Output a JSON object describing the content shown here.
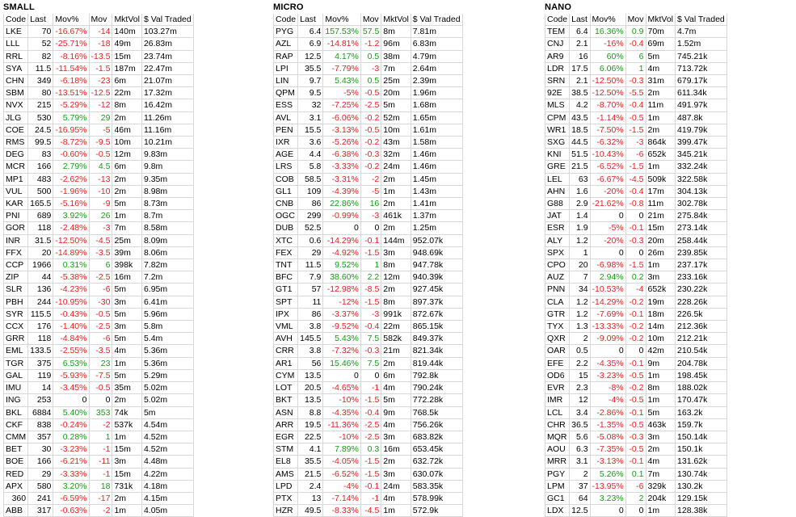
{
  "columns": [
    "Code",
    "Last",
    "Mov%",
    "Mov",
    "MktVol",
    "$ Val Traded"
  ],
  "colors": {
    "negative": "#ee1c1c",
    "positive": "#10a010",
    "grid": "#d8d8d8"
  },
  "panels": [
    {
      "title": "SMALL",
      "rows": [
        [
          "LKE",
          "70",
          "-16.67%",
          "-14",
          "140m",
          "103.27m"
        ],
        [
          "LLL",
          "52",
          "-25.71%",
          "-18",
          "49m",
          "26.83m"
        ],
        [
          "RRL",
          "82",
          "-8.16%",
          "-13.5",
          "15m",
          "23.74m"
        ],
        [
          "SYA",
          "11.5",
          "-11.54%",
          "-1.5",
          "187m",
          "22.47m"
        ],
        [
          "CHN",
          "349",
          "-6.18%",
          "-23",
          "6m",
          "21.07m"
        ],
        [
          "SBM",
          "80",
          "-13.51%",
          "-12.5",
          "22m",
          "17.32m"
        ],
        [
          "NVX",
          "215",
          "-5.29%",
          "-12",
          "8m",
          "16.42m"
        ],
        [
          "JLG",
          "530",
          "5.79%",
          "29",
          "2m",
          "11.26m"
        ],
        [
          "COE",
          "24.5",
          "-16.95%",
          "-5",
          "46m",
          "11.16m"
        ],
        [
          "RMS",
          "99.5",
          "-8.72%",
          "-9.5",
          "10m",
          "10.21m"
        ],
        [
          "DEG",
          "83",
          "-0.60%",
          "-0.5",
          "12m",
          "9.83m"
        ],
        [
          "MCR",
          "166",
          "2.79%",
          "4.5",
          "6m",
          "9.8m"
        ],
        [
          "MP1",
          "483",
          "-2.62%",
          "-13",
          "2m",
          "9.35m"
        ],
        [
          "VUL",
          "500",
          "-1.96%",
          "-10",
          "2m",
          "8.98m"
        ],
        [
          "KAR",
          "165.5",
          "-5.16%",
          "-9",
          "5m",
          "8.73m"
        ],
        [
          "PNI",
          "689",
          "3.92%",
          "26",
          "1m",
          "8.7m"
        ],
        [
          "GOR",
          "118",
          "-2.48%",
          "-3",
          "7m",
          "8.58m"
        ],
        [
          "INR",
          "31.5",
          "-12.50%",
          "-4.5",
          "25m",
          "8.09m"
        ],
        [
          "FFX",
          "20",
          "-14.89%",
          "-3.5",
          "39m",
          "8.06m"
        ],
        [
          "CCP",
          "1966",
          "0.31%",
          "6",
          "398k",
          "7.82m"
        ],
        [
          "ZIP",
          "44",
          "-5.38%",
          "-2.5",
          "16m",
          "7.2m"
        ],
        [
          "SLR",
          "136",
          "-4.23%",
          "-6",
          "5m",
          "6.95m"
        ],
        [
          "PBH",
          "244",
          "-10.95%",
          "-30",
          "3m",
          "6.41m"
        ],
        [
          "SYR",
          "115.5",
          "-0.43%",
          "-0.5",
          "5m",
          "5.96m"
        ],
        [
          "CCX",
          "176",
          "-1.40%",
          "-2.5",
          "3m",
          "5.8m"
        ],
        [
          "GRR",
          "118",
          "-4.84%",
          "-6",
          "5m",
          "5.4m"
        ],
        [
          "EML",
          "133.5",
          "-2.55%",
          "-3.5",
          "4m",
          "5.36m"
        ],
        [
          "TGR",
          "375",
          "6.53%",
          "23",
          "1m",
          "5.36m"
        ],
        [
          "GAL",
          "119",
          "-5.93%",
          "-7.5",
          "5m",
          "5.29m"
        ],
        [
          "IMU",
          "14",
          "-3.45%",
          "-0.5",
          "35m",
          "5.02m"
        ],
        [
          "ING",
          "253",
          "0",
          "0",
          "2m",
          "5.02m"
        ],
        [
          "BKL",
          "6884",
          "5.40%",
          "353",
          "74k",
          "5m"
        ],
        [
          "CKF",
          "838",
          "-0.24%",
          "-2",
          "537k",
          "4.54m"
        ],
        [
          "CMM",
          "357",
          "0.28%",
          "1",
          "1m",
          "4.52m"
        ],
        [
          "BET",
          "30",
          "-3.23%",
          "-1",
          "15m",
          "4.52m"
        ],
        [
          "BOE",
          "166",
          "-6.21%",
          "-11",
          "3m",
          "4.48m"
        ],
        [
          "RED",
          "29",
          "-3.33%",
          "-1",
          "15m",
          "4.22m"
        ],
        [
          "APX",
          "580",
          "3.20%",
          "18",
          "731k",
          "4.18m"
        ],
        [
          "360",
          "241",
          "-6.59%",
          "-17",
          "2m",
          "4.15m"
        ],
        [
          "ABB",
          "317",
          "-0.63%",
          "-2",
          "1m",
          "4.05m"
        ]
      ]
    },
    {
      "title": "MICRO",
      "rows": [
        [
          "PYG",
          "6.4",
          "157.53%",
          "57.5",
          "8m",
          "7.81m"
        ],
        [
          "AZL",
          "6.9",
          "-14.81%",
          "-1.2",
          "96m",
          "6.83m"
        ],
        [
          "RAP",
          "12.5",
          "4.17%",
          "0.5",
          "38m",
          "4.79m"
        ],
        [
          "LPI",
          "35.5",
          "-7.79%",
          "-3",
          "7m",
          "2.64m"
        ],
        [
          "LIN",
          "9.7",
          "5.43%",
          "0.5",
          "25m",
          "2.39m"
        ],
        [
          "QPM",
          "9.5",
          "-5%",
          "-0.5",
          "20m",
          "1.96m"
        ],
        [
          "ESS",
          "32",
          "-7.25%",
          "-2.5",
          "5m",
          "1.68m"
        ],
        [
          "AVL",
          "3.1",
          "-6.06%",
          "-0.2",
          "52m",
          "1.65m"
        ],
        [
          "PEN",
          "15.5",
          "-3.13%",
          "-0.5",
          "10m",
          "1.61m"
        ],
        [
          "IXR",
          "3.6",
          "-5.26%",
          "-0.2",
          "43m",
          "1.58m"
        ],
        [
          "AGE",
          "4.4",
          "-6.38%",
          "-0.3",
          "32m",
          "1.46m"
        ],
        [
          "LRS",
          "5.8",
          "-3.33%",
          "-0.2",
          "24m",
          "1.46m"
        ],
        [
          "COB",
          "58.5",
          "-3.31%",
          "-2",
          "2m",
          "1.45m"
        ],
        [
          "GL1",
          "109",
          "-4.39%",
          "-5",
          "1m",
          "1.43m"
        ],
        [
          "CNB",
          "86",
          "22.86%",
          "16",
          "2m",
          "1.41m"
        ],
        [
          "OGC",
          "299",
          "-0.99%",
          "-3",
          "461k",
          "1.37m"
        ],
        [
          "DUB",
          "52.5",
          "0",
          "0",
          "2m",
          "1.25m"
        ],
        [
          "XTC",
          "0.6",
          "-14.29%",
          "-0.1",
          "144m",
          "952.07k"
        ],
        [
          "FEX",
          "29",
          "-4.92%",
          "-1.5",
          "3m",
          "948.69k"
        ],
        [
          "TNT",
          "11.5",
          "9.52%",
          "1",
          "8m",
          "947.78k"
        ],
        [
          "BFC",
          "7.9",
          "38.60%",
          "2.2",
          "12m",
          "940.39k"
        ],
        [
          "GT1",
          "57",
          "-12.98%",
          "-8.5",
          "2m",
          "927.45k"
        ],
        [
          "SPT",
          "11",
          "-12%",
          "-1.5",
          "8m",
          "897.37k"
        ],
        [
          "IPX",
          "86",
          "-3.37%",
          "-3",
          "991k",
          "872.67k"
        ],
        [
          "VML",
          "3.8",
          "-9.52%",
          "-0.4",
          "22m",
          "865.15k"
        ],
        [
          "AVH",
          "145.5",
          "5.43%",
          "7.5",
          "582k",
          "849.37k"
        ],
        [
          "CRR",
          "3.8",
          "-7.32%",
          "-0.3",
          "21m",
          "821.34k"
        ],
        [
          "AR1",
          "56",
          "15.46%",
          "7.5",
          "2m",
          "819.44k"
        ],
        [
          "CYM",
          "13.5",
          "0",
          "0",
          "6m",
          "792.8k"
        ],
        [
          "LOT",
          "20.5",
          "-4.65%",
          "-1",
          "4m",
          "790.24k"
        ],
        [
          "BKT",
          "13.5",
          "-10%",
          "-1.5",
          "5m",
          "772.28k"
        ],
        [
          "ASN",
          "8.8",
          "-4.35%",
          "-0.4",
          "9m",
          "768.5k"
        ],
        [
          "ARR",
          "19.5",
          "-11.36%",
          "-2.5",
          "4m",
          "756.26k"
        ],
        [
          "EGR",
          "22.5",
          "-10%",
          "-2.5",
          "3m",
          "683.82k"
        ],
        [
          "STM",
          "4.1",
          "7.89%",
          "0.3",
          "16m",
          "653.45k"
        ],
        [
          "EL8",
          "35.5",
          "-4.05%",
          "-1.5",
          "2m",
          "632.72k"
        ],
        [
          "AMS",
          "21.5",
          "-6.52%",
          "-1.5",
          "3m",
          "630.07k"
        ],
        [
          "LPD",
          "2.4",
          "-4%",
          "-0.1",
          "24m",
          "583.35k"
        ],
        [
          "PTX",
          "13",
          "-7.14%",
          "-1",
          "4m",
          "578.99k"
        ],
        [
          "HZR",
          "49.5",
          "-8.33%",
          "-4.5",
          "1m",
          "572.9k"
        ]
      ]
    },
    {
      "title": "NANO",
      "rows": [
        [
          "TEM",
          "6.4",
          "16.36%",
          "0.9",
          "70m",
          "4.7m"
        ],
        [
          "CNJ",
          "2.1",
          "-16%",
          "-0.4",
          "69m",
          "1.52m"
        ],
        [
          "AR9",
          "16",
          "60%",
          "6",
          "5m",
          "745.21k"
        ],
        [
          "LDR",
          "17.5",
          "6.06%",
          "1",
          "4m",
          "713.72k"
        ],
        [
          "SRN",
          "2.1",
          "-12.50%",
          "-0.3",
          "31m",
          "679.17k"
        ],
        [
          "92E",
          "38.5",
          "-12.50%",
          "-5.5",
          "2m",
          "611.34k"
        ],
        [
          "MLS",
          "4.2",
          "-8.70%",
          "-0.4",
          "11m",
          "491.97k"
        ],
        [
          "CPM",
          "43.5",
          "-1.14%",
          "-0.5",
          "1m",
          "487.8k"
        ],
        [
          "WR1",
          "18.5",
          "-7.50%",
          "-1.5",
          "2m",
          "419.79k"
        ],
        [
          "SXG",
          "44.5",
          "-6.32%",
          "-3",
          "864k",
          "399.47k"
        ],
        [
          "KNI",
          "51.5",
          "-10.43%",
          "-6",
          "652k",
          "345.21k"
        ],
        [
          "GRE",
          "21.5",
          "-6.52%",
          "-1.5",
          "1m",
          "332.24k"
        ],
        [
          "LEL",
          "63",
          "-6.67%",
          "-4.5",
          "509k",
          "322.58k"
        ],
        [
          "AHN",
          "1.6",
          "-20%",
          "-0.4",
          "17m",
          "304.13k"
        ],
        [
          "G88",
          "2.9",
          "-21.62%",
          "-0.8",
          "11m",
          "302.78k"
        ],
        [
          "JAT",
          "1.4",
          "0",
          "0",
          "21m",
          "275.84k"
        ],
        [
          "ESR",
          "1.9",
          "-5%",
          "-0.1",
          "15m",
          "273.14k"
        ],
        [
          "ALY",
          "1.2",
          "-20%",
          "-0.3",
          "20m",
          "258.44k"
        ],
        [
          "SPX",
          "1",
          "0",
          "0",
          "26m",
          "239.85k"
        ],
        [
          "CPO",
          "20",
          "-6.98%",
          "-1.5",
          "1m",
          "237.17k"
        ],
        [
          "AUZ",
          "7",
          "2.94%",
          "0.2",
          "3m",
          "233.16k"
        ],
        [
          "PNN",
          "34",
          "-10.53%",
          "-4",
          "652k",
          "230.22k"
        ],
        [
          "CLA",
          "1.2",
          "-14.29%",
          "-0.2",
          "19m",
          "228.26k"
        ],
        [
          "GTR",
          "1.2",
          "-7.69%",
          "-0.1",
          "18m",
          "226.5k"
        ],
        [
          "TYX",
          "1.3",
          "-13.33%",
          "-0.2",
          "14m",
          "212.36k"
        ],
        [
          "QXR",
          "2",
          "-9.09%",
          "-0.2",
          "10m",
          "212.21k"
        ],
        [
          "OAR",
          "0.5",
          "0",
          "0",
          "42m",
          "210.54k"
        ],
        [
          "EFE",
          "2.2",
          "-4.35%",
          "-0.1",
          "9m",
          "204.78k"
        ],
        [
          "OD6",
          "15",
          "-3.23%",
          "-0.5",
          "1m",
          "198.45k"
        ],
        [
          "EVR",
          "2.3",
          "-8%",
          "-0.2",
          "8m",
          "188.02k"
        ],
        [
          "IMR",
          "12",
          "-4%",
          "-0.5",
          "1m",
          "170.47k"
        ],
        [
          "LCL",
          "3.4",
          "-2.86%",
          "-0.1",
          "5m",
          "163.2k"
        ],
        [
          "CHR",
          "36.5",
          "-1.35%",
          "-0.5",
          "463k",
          "159.7k"
        ],
        [
          "MQR",
          "5.6",
          "-5.08%",
          "-0.3",
          "3m",
          "150.14k"
        ],
        [
          "AOU",
          "6.3",
          "-7.35%",
          "-0.5",
          "2m",
          "150.1k"
        ],
        [
          "MRR",
          "3.1",
          "-3.13%",
          "-0.1",
          "4m",
          "131.62k"
        ],
        [
          "PGY",
          "2",
          "5.26%",
          "0.1",
          "7m",
          "130.74k"
        ],
        [
          "LPM",
          "37",
          "-13.95%",
          "-6",
          "329k",
          "130.2k"
        ],
        [
          "GC1",
          "64",
          "3.23%",
          "2",
          "204k",
          "129.15k"
        ],
        [
          "LDX",
          "12.5",
          "0",
          "0",
          "1m",
          "128.38k"
        ]
      ]
    }
  ]
}
